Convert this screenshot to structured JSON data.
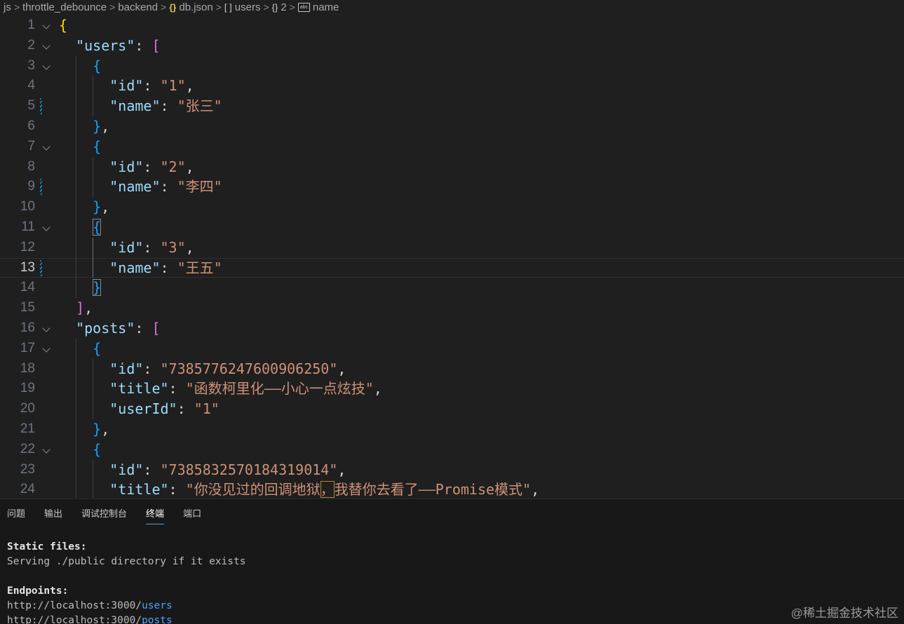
{
  "breadcrumb": {
    "items": [
      "js",
      "throttle_debounce",
      "backend",
      "db.json",
      "users",
      "2",
      "name"
    ],
    "icons": [
      "",
      "",
      "",
      "json-braces-icon",
      "array-brackets-icon",
      "object-braces-icon",
      "string-abc-icon"
    ],
    "icon_glyphs": [
      "",
      "",
      "",
      "{}",
      "[ ]",
      "{}",
      "abc"
    ]
  },
  "editor": {
    "file": "db.json",
    "current_line": 13,
    "line_numbers": [
      "1",
      "2",
      "3",
      "4",
      "5",
      "6",
      "7",
      "8",
      "9",
      "10",
      "11",
      "12",
      "13",
      "14",
      "15",
      "16",
      "17",
      "18",
      "19",
      "20",
      "21",
      "22",
      "23",
      "24"
    ],
    "users_key": "\"users\"",
    "posts_key": "\"posts\"",
    "id_key": "\"id\"",
    "name_key": "\"name\"",
    "title_key": "\"title\"",
    "userId_key": "\"userId\"",
    "users": [
      {
        "id": "\"1\"",
        "name": "\"张三\""
      },
      {
        "id": "\"2\"",
        "name": "\"李四\""
      },
      {
        "id": "\"3\"",
        "name": "\"王五\""
      }
    ],
    "posts": [
      {
        "id": "\"7385776247600906250\"",
        "title": "\"函数柯里化——小心一点炫技\"",
        "userId": "\"1\""
      },
      {
        "id": "\"7385832570184319014\"",
        "title_a": "\"你没见过的回调地狱",
        "title_caret": "，",
        "title_b": "我替你去看了——Promise模式\""
      }
    ]
  },
  "panel": {
    "tabs": [
      "问题",
      "输出",
      "调试控制台",
      "终端",
      "端口"
    ],
    "active_tab": "终端",
    "terminal": {
      "static_heading": "Static files:",
      "static_line": "Serving ./public directory if it exists",
      "endpoints_heading": "Endpoints:",
      "endpoint_base": "http://localhost:3000/",
      "endpoint_users": "users",
      "endpoint_posts": "posts"
    }
  },
  "watermark": "@稀土掘金技术社区",
  "colors": {
    "background": "#1f1f1f",
    "key": "#9cdcfe",
    "string": "#ce9178",
    "bracket_level1": "#ffd700",
    "bracket_level2": "#da70d6",
    "bracket_level3": "#179fff",
    "terminal_link": "#4fa0ff"
  }
}
